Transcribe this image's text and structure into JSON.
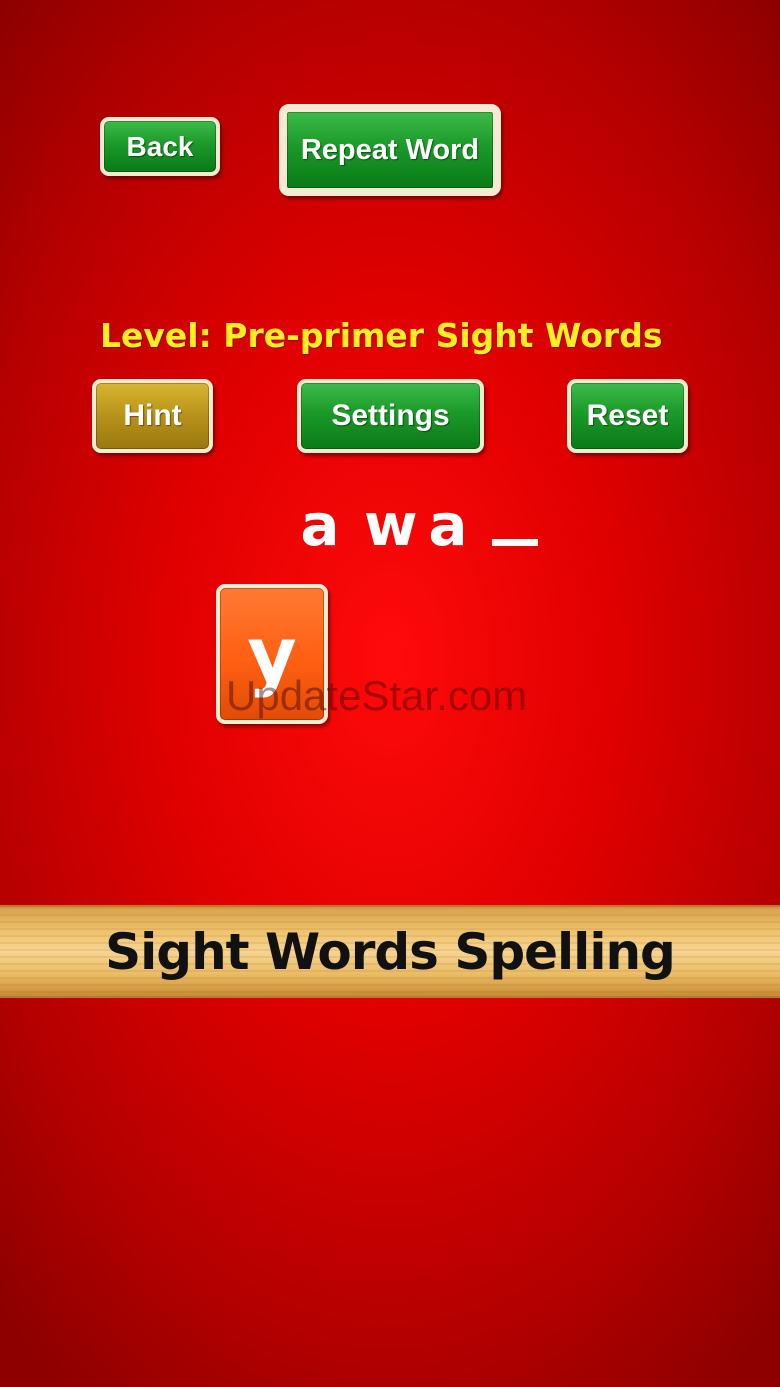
{
  "top_buttons": {
    "back_label": "Back",
    "repeat_label": "Repeat Word"
  },
  "level": {
    "text": "Level: Pre-primer Sight Words"
  },
  "controls": {
    "hint_label": "Hint",
    "settings_label": "Settings",
    "reset_label": "Reset"
  },
  "word": {
    "letters": [
      "a",
      "w",
      "a"
    ],
    "blank": "_"
  },
  "letter_tiles": [
    "y"
  ],
  "watermark": "UpdateStar.com",
  "title": "Sight Words Spelling",
  "colors": {
    "background": "#e00000",
    "button_green": "#1b9a2a",
    "button_gold": "#b8921a",
    "tile_orange": "#ff5f12",
    "level_text": "#ffee22",
    "banner_wood": "#f0c572"
  }
}
